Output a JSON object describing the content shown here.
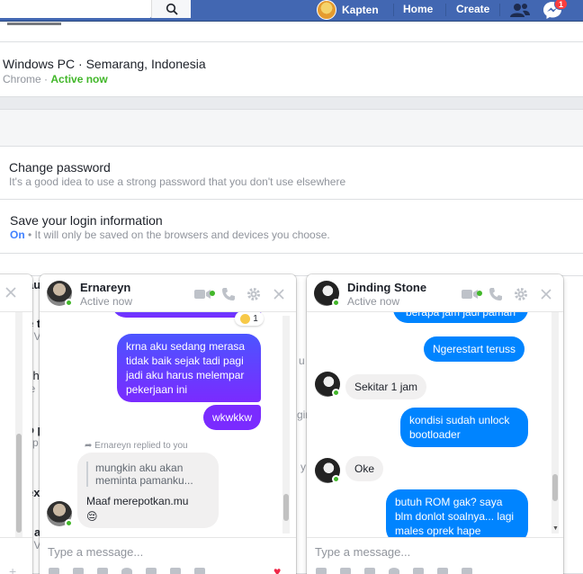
{
  "topbar": {
    "profile_name": "Kapten",
    "home": "Home",
    "create": "Create",
    "messenger_badge": "1"
  },
  "settings": {
    "session": {
      "device": "Windows PC · Semarang, Indonesia",
      "browser": "Chrome",
      "status": "Active now"
    },
    "change_password": {
      "title": "Change password",
      "desc": "It's a good idea to use a strong password that you don't use elsewhere"
    },
    "save_login": {
      "title": "Save your login information",
      "state": "On",
      "desc": "• It will only be saved on the browsers and devices you choose."
    },
    "partial_rows": {
      "a": "aut",
      "b_title": "ch",
      "b_sub": "ie",
      "c_title": "o p",
      "c_sub": "sp",
      "d": "ext",
      "e_title": "t a",
      "e_sub": "• V",
      "f_title": "e t",
      "f_sub": "• V",
      "right_a": "u",
      "right_b": "gin",
      "right_c": "y"
    }
  },
  "chat_left": {
    "name": "Ernareyn",
    "status": "Active now",
    "reaction_count": "1",
    "messages": [
      "krna aku sedang merasa tidak baik sejak tadi pagi jadi aku harus melempar pekerjaan ini",
      "wkwkkw"
    ],
    "reply_note": "Ernareyn replied to you",
    "quoted": "mungkin aku akan meminta pamanku...",
    "reply": "Maaf merepotkan.mu",
    "reply_emoji": "😔",
    "placeholder": "Type a message..."
  },
  "chat_right": {
    "name": "Dinding Stone",
    "status": "Active now",
    "messages": [
      {
        "from": "me",
        "text": "berapa jam jadi paman"
      },
      {
        "from": "me",
        "text": "Ngerestart teruss"
      },
      {
        "from": "them",
        "text": "Sekitar 1 jam"
      },
      {
        "from": "me",
        "text": "kondisi sudah unlock bootloader"
      },
      {
        "from": "them",
        "text": "Oke"
      },
      {
        "from": "me",
        "text": "butuh ROM gak? saya blm donlot soalnya... lagi males oprek hape"
      }
    ],
    "placeholder": "Type a message..."
  },
  "colors": {
    "brand": "#4267b2",
    "active": "#42b72a",
    "bubble_blue": "#0084ff",
    "bubble_purple": "#6a3bff"
  }
}
